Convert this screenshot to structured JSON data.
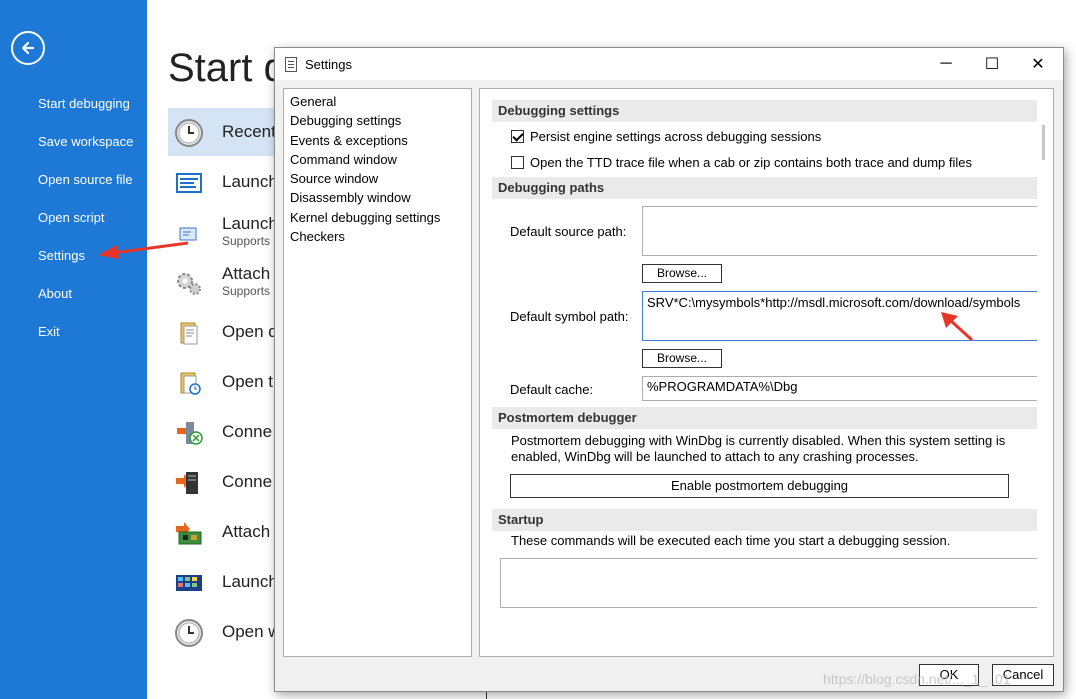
{
  "backstage": {
    "nav": {
      "items": [
        {
          "label": "Start debugging"
        },
        {
          "label": "Save workspace"
        },
        {
          "label": "Open source file"
        },
        {
          "label": "Open script"
        },
        {
          "label": "Settings"
        },
        {
          "label": "About"
        },
        {
          "label": "Exit"
        }
      ]
    },
    "title": "Start d",
    "items": [
      {
        "label": "Recent",
        "sub": "",
        "icon": "clock-icon"
      },
      {
        "label": "Launch",
        "sub": "",
        "icon": "window-icon"
      },
      {
        "label": "Launch",
        "sub": "Supports",
        "icon": "app-package-icon"
      },
      {
        "label": "Attach",
        "sub": "Supports",
        "icon": "gears-icon"
      },
      {
        "label": "Open d",
        "sub": "",
        "icon": "folder-file-icon"
      },
      {
        "label": "Open t",
        "sub": "",
        "icon": "folder-trace-icon"
      },
      {
        "label": "Conne",
        "sub": "",
        "icon": "remote-connect-icon"
      },
      {
        "label": "Conne",
        "sub": "",
        "icon": "server-connect-icon"
      },
      {
        "label": "Attach",
        "sub": "",
        "icon": "kernel-board-icon"
      },
      {
        "label": "Launch",
        "sub": "",
        "icon": "grid-window-icon"
      },
      {
        "label": "Open w",
        "sub": "",
        "icon": "clock-icon"
      }
    ]
  },
  "dialog": {
    "title": "Settings",
    "controls": {
      "minimize": "─",
      "maximize": "☐",
      "close": "✕"
    },
    "categories": [
      "General",
      "Debugging settings",
      "Events & exceptions",
      "Command window",
      "Source window",
      "Disassembly window",
      "Kernel debugging settings",
      "Checkers"
    ],
    "debugging_settings": {
      "header": "Debugging settings",
      "persist_label": "Persist engine settings across debugging sessions",
      "persist_checked": true,
      "ttd_label": "Open the TTD trace file when a cab or zip contains both trace and dump files",
      "ttd_checked": false
    },
    "debugging_paths": {
      "header": "Debugging paths",
      "source_label": "Default source path:",
      "source_value": "",
      "browse1": "Browse...",
      "symbol_label": "Default symbol path:",
      "symbol_value": "SRV*C:\\mysymbols*http://msdl.microsoft.com/download/symbols",
      "browse2": "Browse...",
      "cache_label": "Default cache:",
      "cache_value": "%PROGRAMDATA%\\Dbg"
    },
    "postmortem": {
      "header": "Postmortem debugger",
      "description": "Postmortem debugging with WinDbg is currently disabled. When this system setting is enabled, WinDbg will be launched to attach to any crashing processes.",
      "button": "Enable postmortem debugging"
    },
    "startup": {
      "header": "Startup",
      "description": "These commands will be executed each time you start a debugging session.",
      "commands": ""
    },
    "ok": "OK",
    "cancel": "Cancel"
  },
  "watermark": "https://blog.csdn.net/..._1_..01",
  "colors": {
    "nav_bg": "#1d78d6",
    "recent_highlight": "#d5e4f5",
    "annotation_arrow": "#e8352a"
  }
}
